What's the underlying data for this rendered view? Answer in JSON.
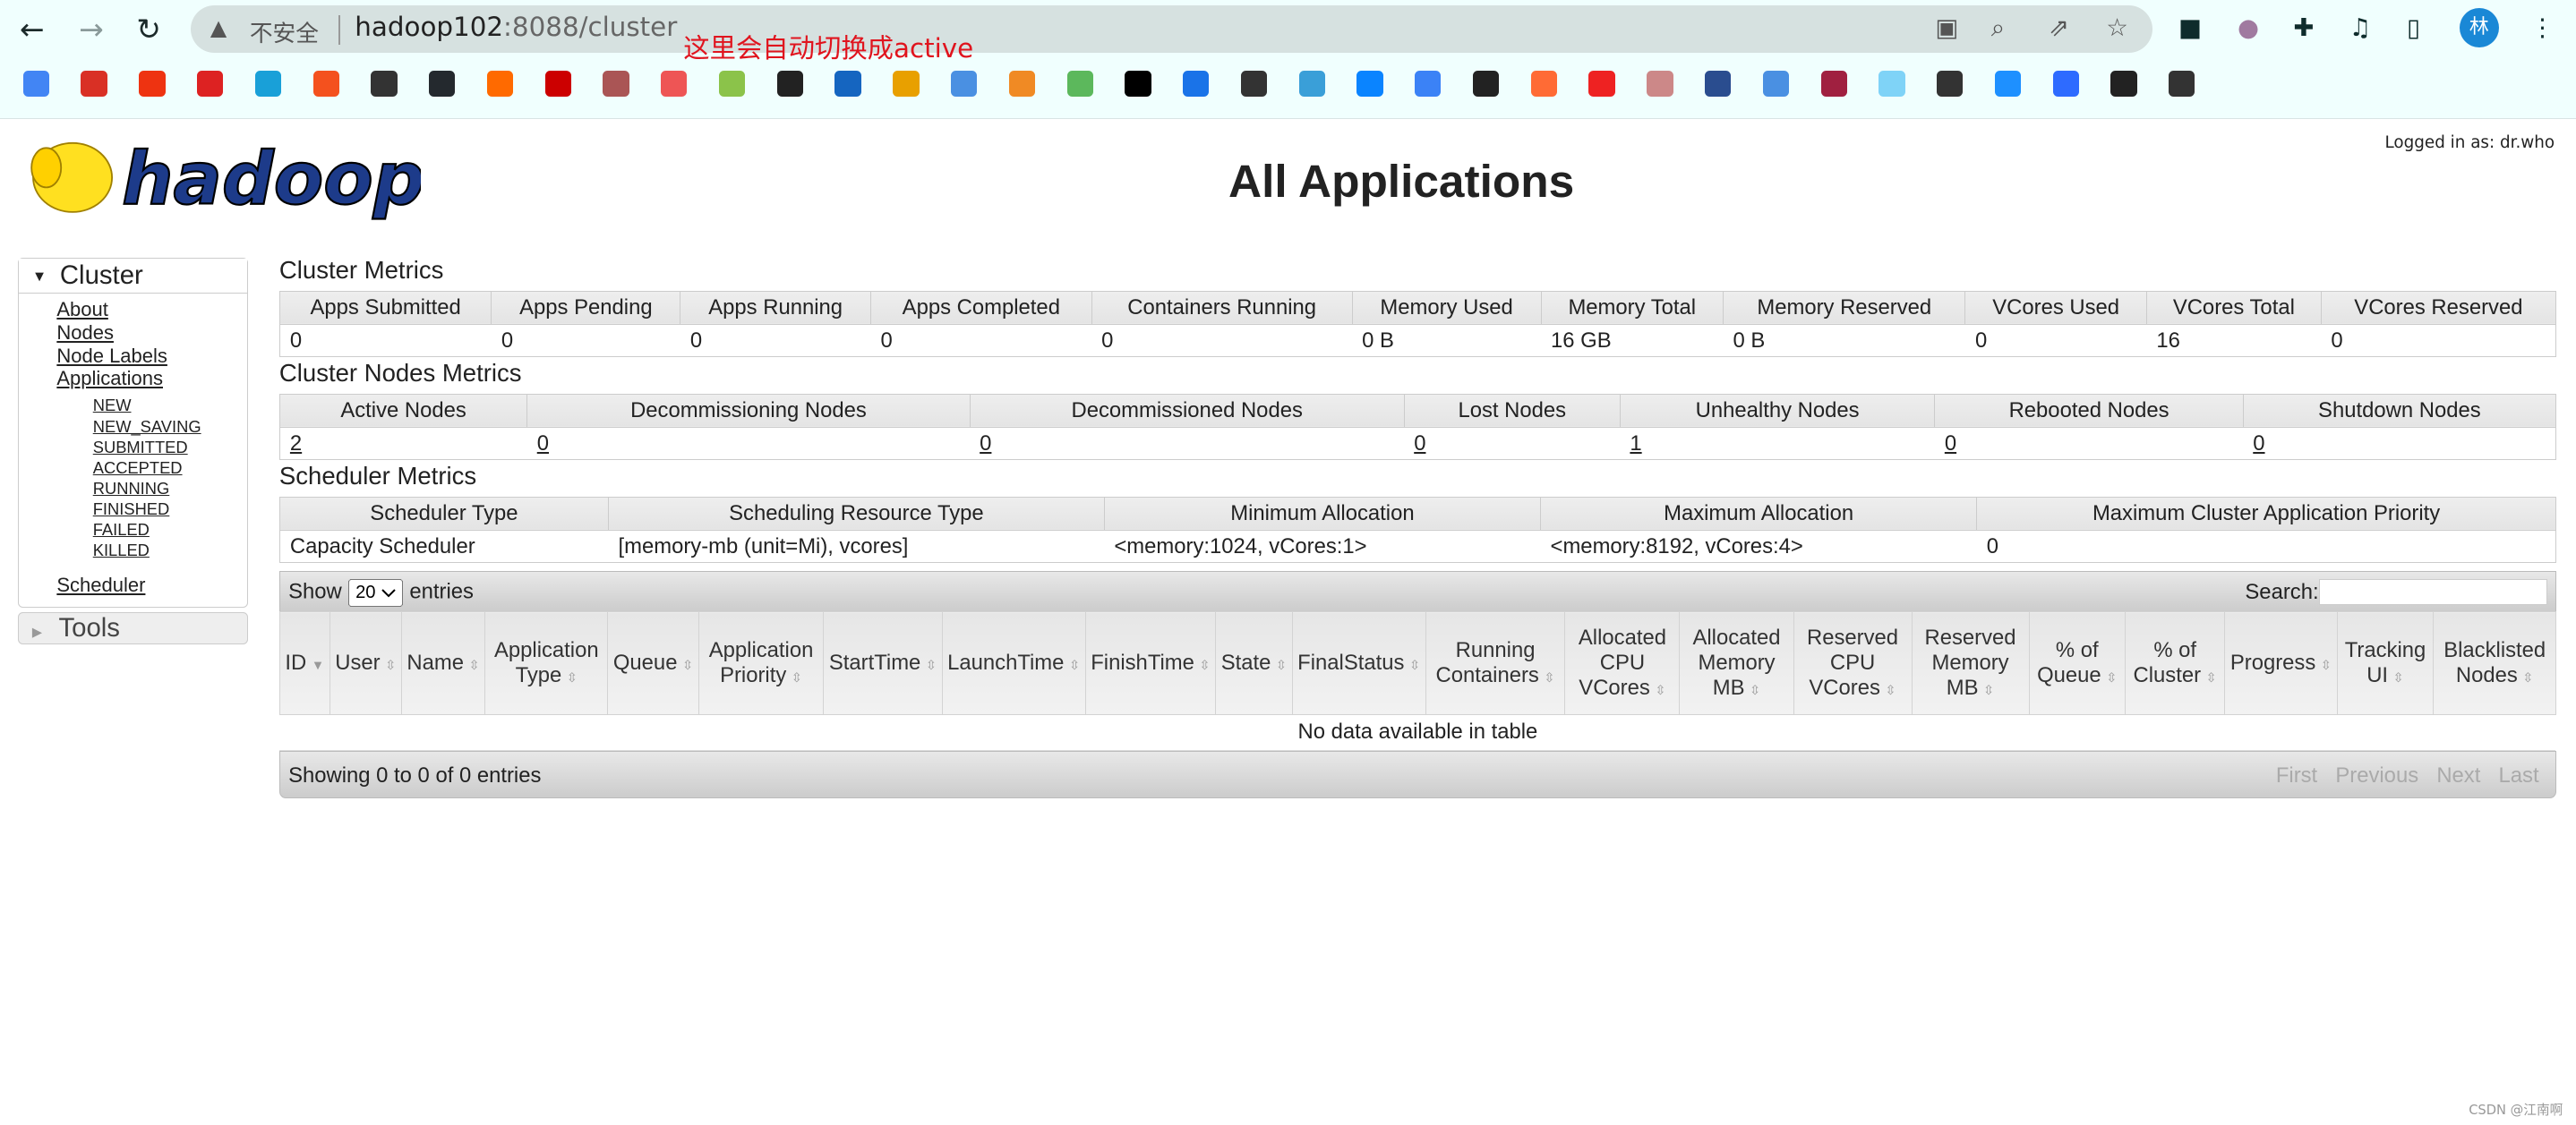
{
  "browser": {
    "insecure_label": "不安全",
    "url_host": "hadoop102",
    "url_rest": ":8088/cluster",
    "annotation": "这里会自动切换成active",
    "avatar_label": "林",
    "bookmark_count": 38
  },
  "header": {
    "title": "All Applications",
    "logged_in": "Logged in as: dr.who"
  },
  "sidebar": {
    "cluster_label": "Cluster",
    "links": [
      "About",
      "Nodes",
      "Node Labels",
      "Applications"
    ],
    "app_states": [
      "NEW",
      "NEW_SAVING",
      "SUBMITTED",
      "ACCEPTED",
      "RUNNING",
      "FINISHED",
      "FAILED",
      "KILLED"
    ],
    "scheduler": "Scheduler",
    "tools_label": "Tools"
  },
  "cluster_metrics": {
    "title": "Cluster Metrics",
    "headers": [
      "Apps Submitted",
      "Apps Pending",
      "Apps Running",
      "Apps Completed",
      "Containers Running",
      "Memory Used",
      "Memory Total",
      "Memory Reserved",
      "VCores Used",
      "VCores Total",
      "VCores Reserved"
    ],
    "values": [
      "0",
      "0",
      "0",
      "0",
      "0",
      "0 B",
      "16 GB",
      "0 B",
      "0",
      "16",
      "0"
    ]
  },
  "nodes_metrics": {
    "title": "Cluster Nodes Metrics",
    "headers": [
      "Active Nodes",
      "Decommissioning Nodes",
      "Decommissioned Nodes",
      "Lost Nodes",
      "Unhealthy Nodes",
      "Rebooted Nodes",
      "Shutdown Nodes"
    ],
    "values": [
      "2",
      "0",
      "0",
      "0",
      "1",
      "0",
      "0"
    ]
  },
  "scheduler_metrics": {
    "title": "Scheduler Metrics",
    "headers": [
      "Scheduler Type",
      "Scheduling Resource Type",
      "Minimum Allocation",
      "Maximum Allocation",
      "Maximum Cluster Application Priority"
    ],
    "values": [
      "Capacity Scheduler",
      "[memory-mb (unit=Mi), vcores]",
      "<memory:1024, vCores:1>",
      "<memory:8192, vCores:4>",
      "0"
    ]
  },
  "apps_table": {
    "show_label": "Show",
    "page_size": "20",
    "entries_label": "entries",
    "search_label": "Search:",
    "search_value": "",
    "columns": [
      "ID",
      "User",
      "Name",
      "Application Type",
      "Queue",
      "Application Priority",
      "StartTime",
      "LaunchTime",
      "FinishTime",
      "State",
      "FinalStatus",
      "Running Containers",
      "Allocated CPU VCores",
      "Allocated Memory MB",
      "Reserved CPU VCores",
      "Reserved Memory MB",
      "% of Queue",
      "% of Cluster",
      "Progress",
      "Tracking UI",
      "Blacklisted Nodes"
    ],
    "empty": "No data available in table",
    "info": "Showing 0 to 0 of 0 entries",
    "pager": [
      "First",
      "Previous",
      "Next",
      "Last"
    ]
  },
  "watermark": "CSDN @江南啊"
}
